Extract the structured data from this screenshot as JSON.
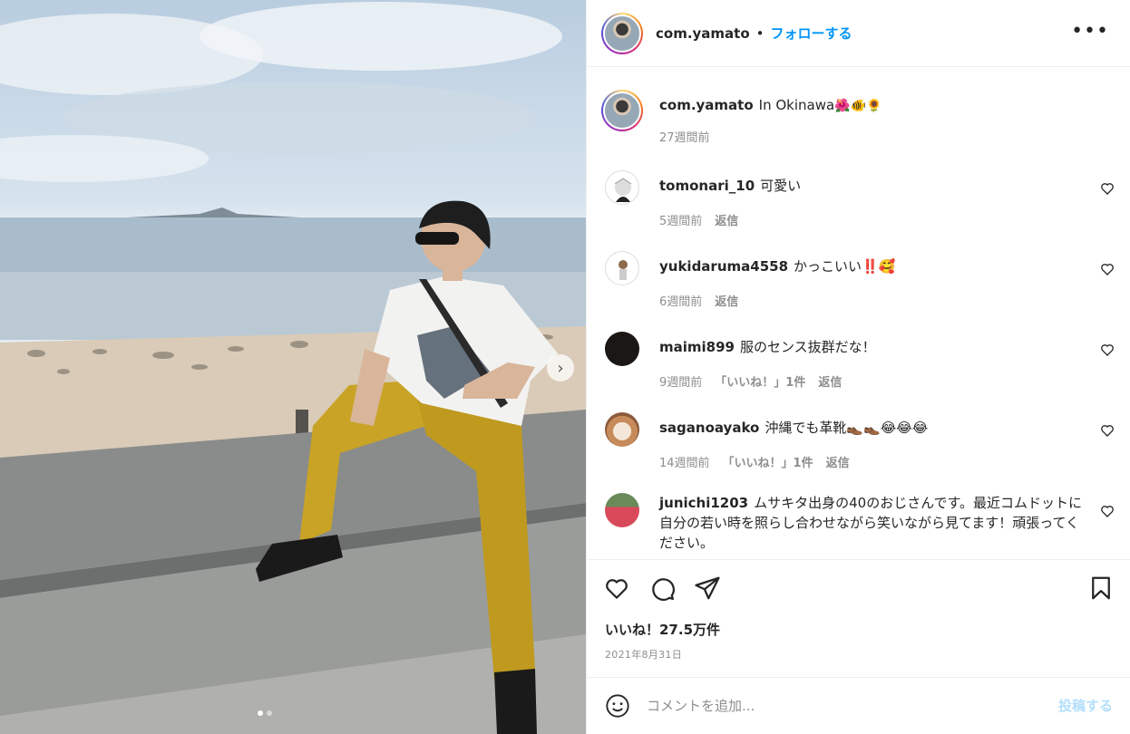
{
  "post": {
    "author": "com.yamato",
    "separator": "•",
    "follow_label": "フォローする",
    "more_label": "•••",
    "caption_text": "In Okinawa",
    "caption_emoji": "🌺🐠🌻",
    "caption_time": "27週間前"
  },
  "comments": [
    {
      "user": "tomonari_10",
      "text": "可愛い",
      "time": "5週間前",
      "likes": "",
      "reply": "返信"
    },
    {
      "user": "yukidaruma4558",
      "text": "かっこいい‼️🥰",
      "time": "6週間前",
      "likes": "",
      "reply": "返信"
    },
    {
      "user": "maimi899",
      "text": "服のセンス抜群だな！",
      "time": "9週間前",
      "likes": "「いいね！」1件",
      "reply": "返信"
    },
    {
      "user": "saganoayako",
      "text": "沖縄でも革靴👞👞😂😂😂",
      "time": "14週間前",
      "likes": "「いいね！」1件",
      "reply": "返信"
    },
    {
      "user": "junichi1203",
      "text": "ムサキタ出身の40のおじさんです。最近コムドットに自分の若い時を照らし合わせながら笑いながら見てます！頑張ってください。",
      "time": "",
      "likes": "",
      "reply": ""
    }
  ],
  "footer": {
    "likes": "いいね！27.5万件",
    "date": "2021年8月31日",
    "comment_placeholder": "コメントを追加...",
    "post_label": "投稿する"
  },
  "icons": {
    "like": "heart-icon",
    "comment": "comment-bubble-icon",
    "share": "paper-plane-icon",
    "save": "bookmark-icon",
    "emoji": "smiley-icon",
    "next": "chevron-right-icon"
  },
  "colors": {
    "accent": "#0095f6",
    "post_disabled": "#b2dffc",
    "muted": "#8e8e8e",
    "pants": "#c9a325"
  }
}
